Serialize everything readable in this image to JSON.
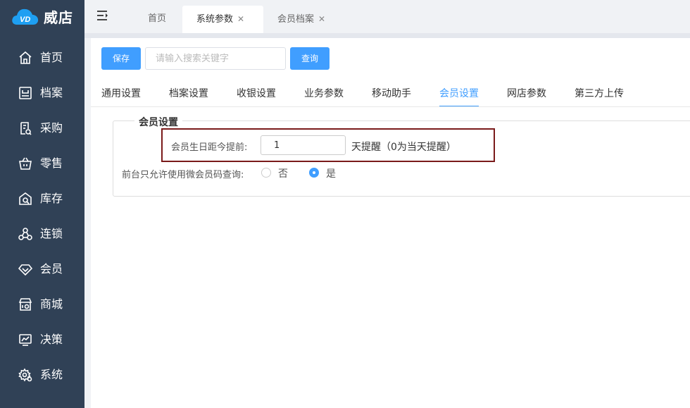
{
  "app": {
    "name": "威店",
    "logo_text": "VD"
  },
  "sidebar": {
    "items": [
      {
        "label": "首页",
        "icon": "home-icon"
      },
      {
        "label": "档案",
        "icon": "archive-icon"
      },
      {
        "label": "采购",
        "icon": "purchase-icon"
      },
      {
        "label": "零售",
        "icon": "basket-icon"
      },
      {
        "label": "库存",
        "icon": "warehouse-icon"
      },
      {
        "label": "连锁",
        "icon": "chain-icon"
      },
      {
        "label": "会员",
        "icon": "diamond-icon"
      },
      {
        "label": "商城",
        "icon": "shop-icon"
      },
      {
        "label": "决策",
        "icon": "chart-icon"
      },
      {
        "label": "系统",
        "icon": "gear-icon"
      }
    ]
  },
  "tabs": [
    {
      "label": "首页",
      "closable": false,
      "active": false
    },
    {
      "label": "系统参数",
      "closable": true,
      "active": true
    },
    {
      "label": "会员档案",
      "closable": true,
      "active": false
    }
  ],
  "toolbar": {
    "save_label": "保存",
    "search_placeholder": "请输入搜索关键字",
    "search_value": "",
    "query_label": "查询"
  },
  "settings_tabs": [
    {
      "label": "通用设置",
      "active": false
    },
    {
      "label": "档案设置",
      "active": false
    },
    {
      "label": "收银设置",
      "active": false
    },
    {
      "label": "业务参数",
      "active": false
    },
    {
      "label": "移动助手",
      "active": false
    },
    {
      "label": "会员设置",
      "active": true
    },
    {
      "label": "网店参数",
      "active": false
    },
    {
      "label": "第三方上传",
      "active": false
    }
  ],
  "member_settings": {
    "legend": "会员设置",
    "birthday_label": "会员生日距今提前:",
    "birthday_value": "1",
    "birthday_hint": "天提醒（0为当天提醒）",
    "wechat_only_label": "前台只允许使用微会员码查询:",
    "options": [
      {
        "label": "否",
        "checked": false
      },
      {
        "label": "是",
        "checked": true
      }
    ]
  },
  "colors": {
    "sidebar_bg": "#304156",
    "accent": "#409eff",
    "highlight_border": "#7a1a1a"
  }
}
